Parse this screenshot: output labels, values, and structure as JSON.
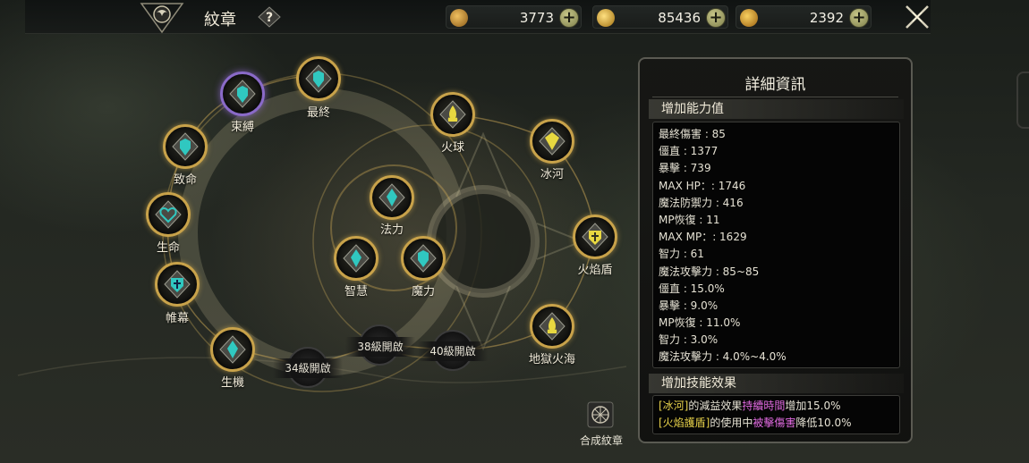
{
  "header": {
    "title": "紋章",
    "help_icon": "question-icon",
    "currencies": [
      {
        "name": "cycle-currency",
        "value": "3773",
        "color": "#d8a040"
      },
      {
        "name": "gold-coin-currency",
        "value": "85436",
        "color": "#e0b030"
      },
      {
        "name": "small-coin-currency",
        "value": "2392",
        "color": "#d89a30"
      }
    ],
    "plus_label": "+",
    "close_icon": "close-x-icon"
  },
  "tree": {
    "nodes": [
      {
        "id": "final",
        "label": "最終",
        "icon": "armor-icon"
      },
      {
        "id": "bind",
        "label": "束縛",
        "icon": "armor-icon",
        "selected": true
      },
      {
        "id": "fatal",
        "label": "致命",
        "icon": "armor-icon"
      },
      {
        "id": "life",
        "label": "生命",
        "icon": "heart-icon"
      },
      {
        "id": "curtain",
        "label": "帷幕",
        "icon": "cross-shield-icon"
      },
      {
        "id": "vitality",
        "label": "生機",
        "icon": "crystal-icon"
      },
      {
        "id": "mana",
        "label": "法力",
        "icon": "crystal-icon"
      },
      {
        "id": "wisdom",
        "label": "智慧",
        "icon": "crystal-icon"
      },
      {
        "id": "magic",
        "label": "魔力",
        "icon": "armor-icon"
      },
      {
        "id": "fireball",
        "label": "火球",
        "icon": "flame-icon"
      },
      {
        "id": "glacier",
        "label": "冰河",
        "icon": "ice-icon"
      },
      {
        "id": "fire-shield",
        "label": "火焰盾",
        "icon": "shield-icon"
      },
      {
        "id": "inferno",
        "label": "地獄火海",
        "icon": "flame-icon"
      }
    ],
    "locked": [
      {
        "id": "lock34",
        "label": "34級開啟"
      },
      {
        "id": "lock38",
        "label": "38級開啟"
      },
      {
        "id": "lock40",
        "label": "40級開啟"
      }
    ]
  },
  "compose": {
    "label": "合成紋章",
    "icon": "compose-icon"
  },
  "detail": {
    "title": "詳細資訊",
    "stats_title": "增加能力值",
    "stats": [
      "最終傷害 : 85",
      "僵直 : 1377",
      "暴擊 : 739",
      "MAX HP：: 1746",
      "魔法防禦力 : 416",
      "MP恢復 : 11",
      "MAX MP：: 1629",
      "智力 : 61",
      "魔法攻擊力 : 85~85",
      "僵直 : 15.0%",
      "暴擊 : 9.0%",
      "MP恢復 : 11.0%",
      "智力 : 3.0%",
      "魔法攻擊力 : 4.0%~4.0%"
    ],
    "skills_title": "增加技能效果",
    "skills": [
      {
        "a": "[冰河]",
        "b": "的減益效果",
        "c": "持續時間",
        "d": "增加15.0%"
      },
      {
        "a": "[火焰護盾]",
        "b": "的使用中",
        "c": "被擊傷害",
        "d": "降低10.0%"
      }
    ]
  }
}
